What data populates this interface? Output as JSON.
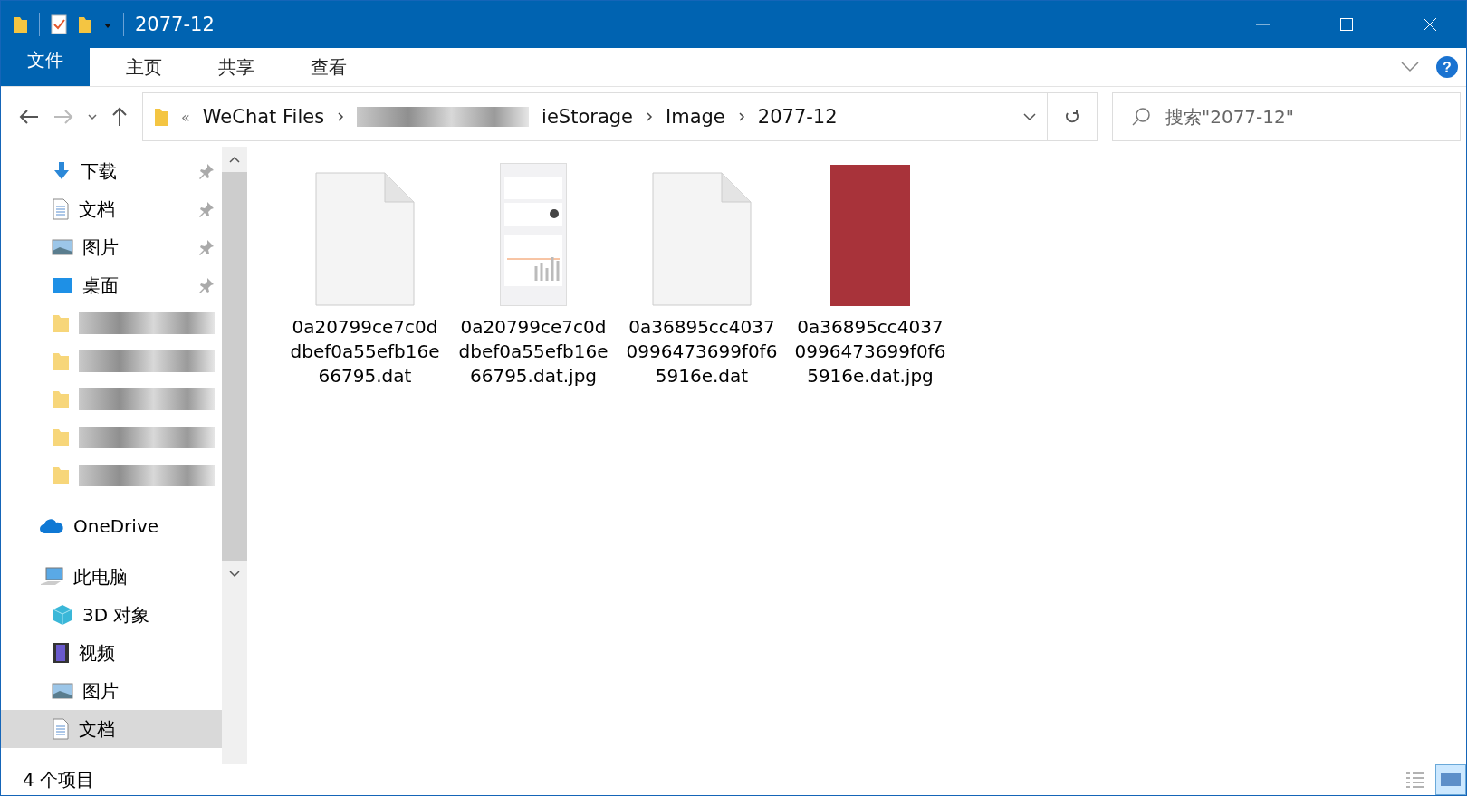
{
  "window": {
    "title": "2077-12"
  },
  "ribbon_tabs": [
    {
      "label": "文件",
      "kind": "file",
      "selected": false
    },
    {
      "label": "主页",
      "kind": "tab",
      "selected": false
    },
    {
      "label": "共享",
      "kind": "tab",
      "selected": false
    },
    {
      "label": "查看",
      "kind": "tab",
      "selected": false
    }
  ],
  "help": {
    "label": "?"
  },
  "address": {
    "prefix": "«",
    "segments": [
      {
        "label": "WeChat Files",
        "kind": "text"
      },
      {
        "kind": "redacted"
      },
      {
        "label": "ieStorage",
        "kind": "text"
      },
      {
        "label": "Image",
        "kind": "text"
      },
      {
        "label": "2077-12",
        "kind": "text"
      }
    ]
  },
  "search": {
    "placeholder": "搜索\"2077-12\""
  },
  "nav": [
    {
      "label": "下载",
      "kind": "download",
      "pinned": true,
      "selected": false
    },
    {
      "label": "文档",
      "kind": "document",
      "pinned": true,
      "selected": false
    },
    {
      "label": "图片",
      "kind": "picture",
      "pinned": true,
      "selected": false
    },
    {
      "label": "桌面",
      "kind": "desktop",
      "pinned": true,
      "selected": false
    },
    {
      "kind": "redacted",
      "selected": false
    },
    {
      "kind": "redacted",
      "selected": false
    },
    {
      "kind": "redacted",
      "selected": false
    },
    {
      "kind": "redacted",
      "selected": false
    },
    {
      "kind": "redacted",
      "selected": false
    },
    {
      "label": "OneDrive",
      "kind": "cloud",
      "pinned": false,
      "selected": false
    },
    {
      "label": "此电脑",
      "kind": "computer",
      "pinned": false,
      "selected": false
    },
    {
      "label": "3D 对象",
      "kind": "cube",
      "pinned": false,
      "selected": false
    },
    {
      "label": "视频",
      "kind": "film",
      "pinned": false,
      "selected": false
    },
    {
      "label": "图片",
      "kind": "picture",
      "pinned": false,
      "selected": false
    },
    {
      "label": "文档",
      "kind": "document",
      "pinned": false,
      "selected": true
    }
  ],
  "files": [
    {
      "name": "0a20799ce7c0d dbef0a55efb16e 66795.dat",
      "kind": "blank"
    },
    {
      "name": "0a20799ce7c0d dbef0a55efb16e 66795.dat.jpg",
      "kind": "screenshot"
    },
    {
      "name": "0a36895cc4037 0996473699f0f6 5916e.dat",
      "kind": "blank"
    },
    {
      "name": "0a36895cc4037 0996473699f0f6 5916e.dat.jpg",
      "kind": "photo"
    }
  ],
  "status_bar": {
    "count": "4 个项目"
  }
}
